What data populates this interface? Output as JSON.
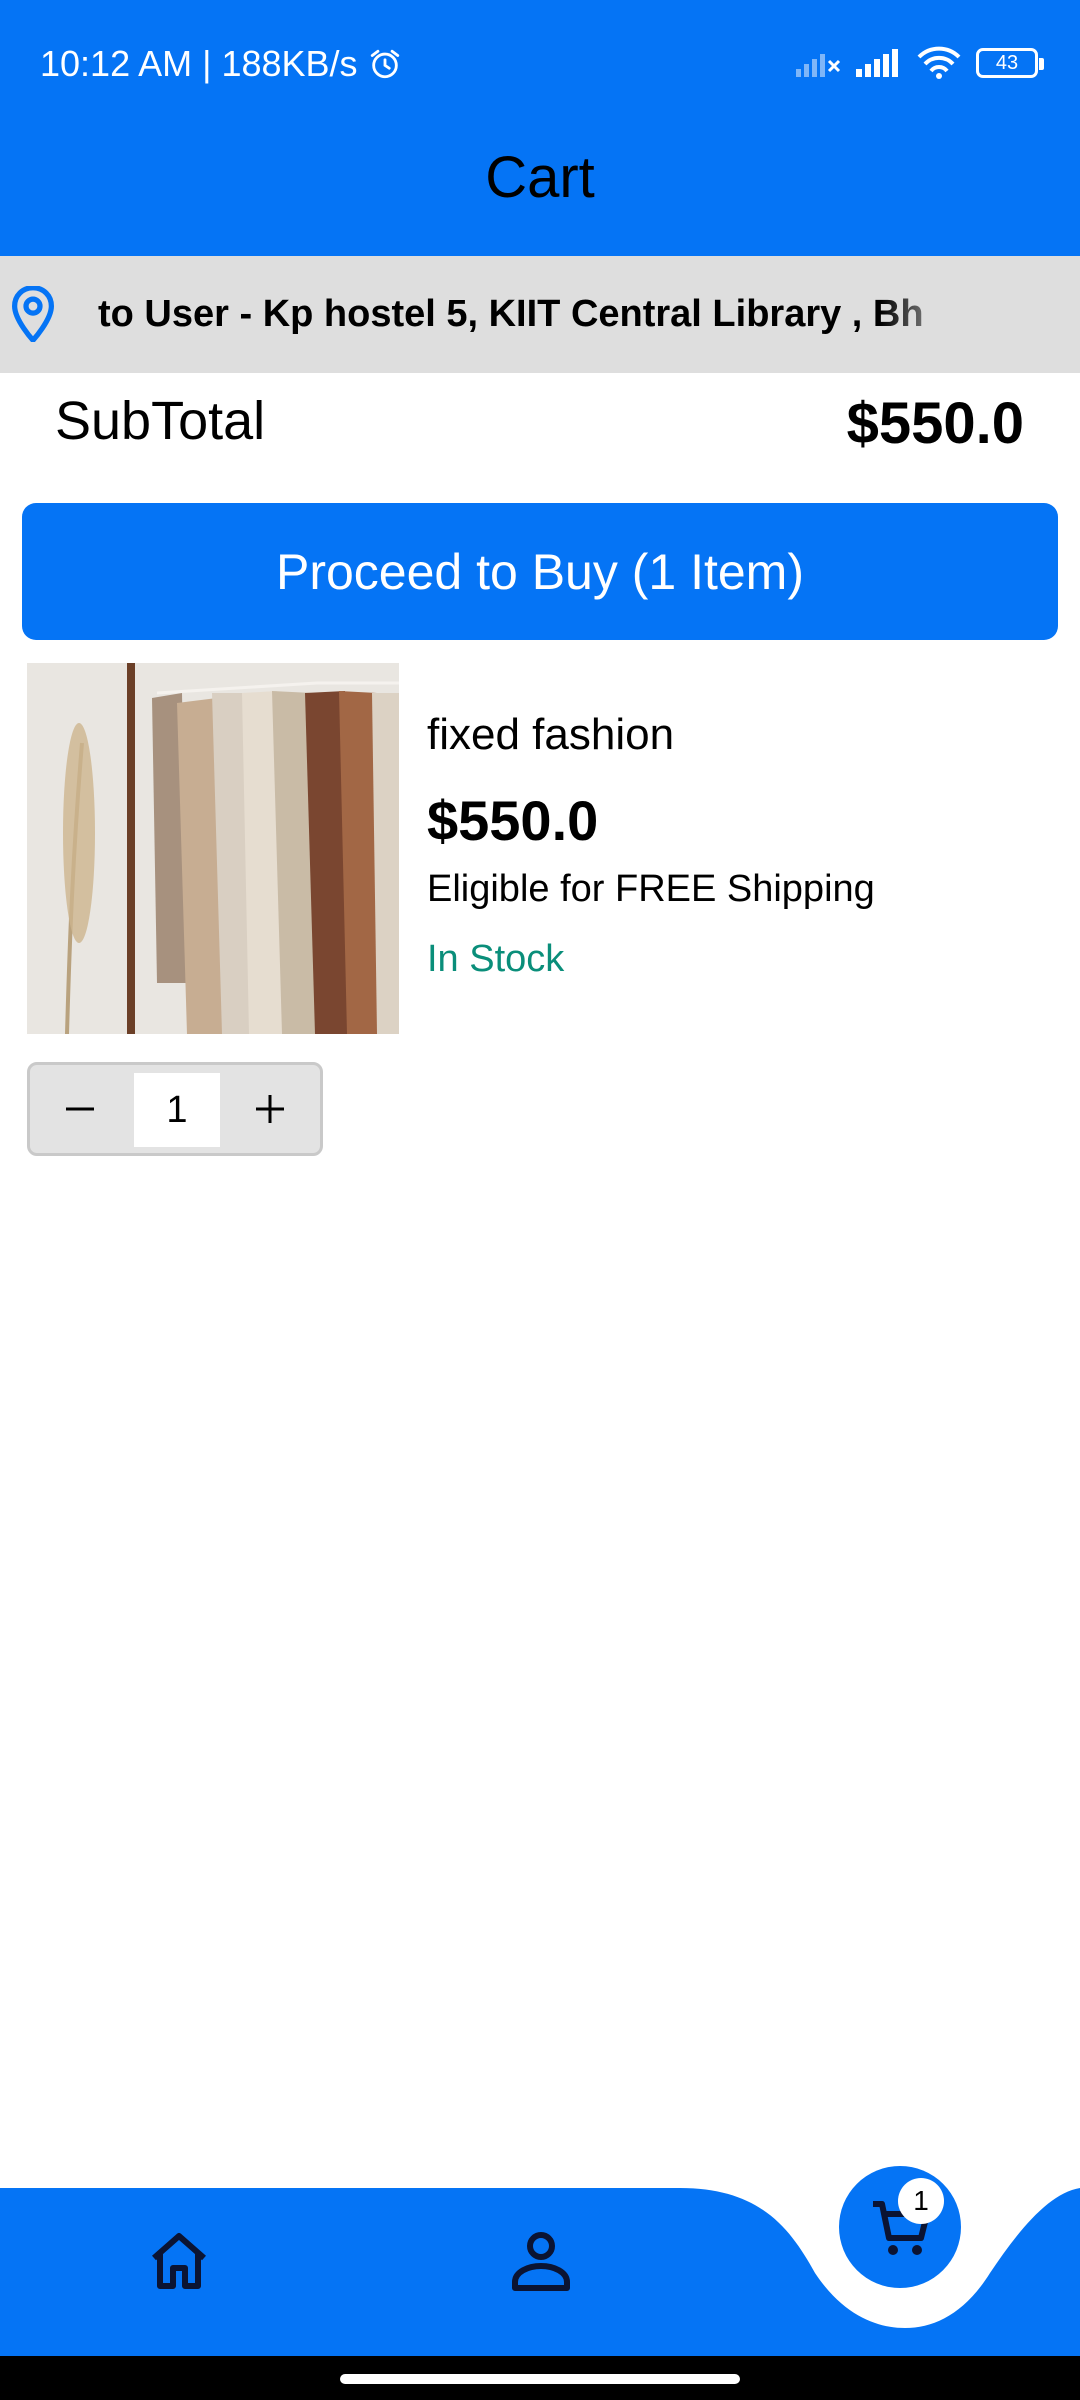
{
  "status_bar": {
    "time_speed": "10:12 AM | 188KB/s",
    "battery": "43"
  },
  "app_bar": {
    "title": "Cart"
  },
  "address": {
    "text": "to User - Kp hostel 5, KIIT Central Library , Bh",
    "icon": "location-pin-icon"
  },
  "summary": {
    "subtotal_label": "SubTotal",
    "subtotal_value": "$550.0"
  },
  "proceed_button": {
    "label": "Proceed to Buy (1 Item)"
  },
  "cart_items": [
    {
      "name": "fixed fashion",
      "price": "$550.0",
      "shipping": "Eligible for FREE Shipping",
      "stock": "In Stock",
      "quantity": "1"
    }
  ],
  "bottom_nav": {
    "items": [
      "home-icon",
      "profile-icon",
      "cart-icon"
    ],
    "cart_badge": "1"
  },
  "colors": {
    "primary": "#0574f5",
    "stock": "#0a8e7a",
    "address_bg": "#dedede"
  }
}
